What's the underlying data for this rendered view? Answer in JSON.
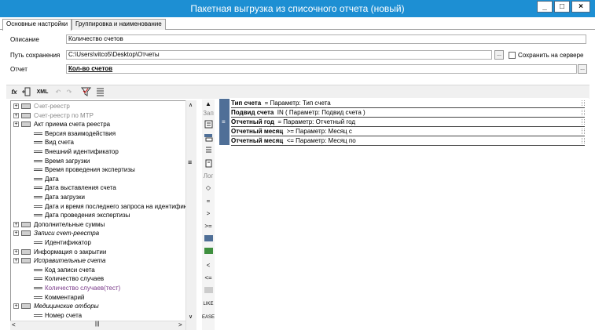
{
  "window": {
    "title": "Пакетная выгрузка из списочного отчета (новый)",
    "minimize": "_",
    "maximize": "□",
    "close": "×"
  },
  "tabs": [
    {
      "label": "Основные настройки",
      "active": true
    },
    {
      "label": "Группировка и наименование",
      "active": false
    }
  ],
  "form": {
    "description_label": "Описание",
    "description_value": "Количество счетов",
    "save_path_label": "Путь сохранения",
    "save_path_value": "C:\\Users\\vitco5\\Desktop\\Отчеты",
    "browse_label": "...",
    "save_on_server_label": "Сохранить на сервере",
    "report_label": "Отчет",
    "report_value": "Кол-во счетов",
    "report_browse_label": "..."
  },
  "toolbar": {
    "fx": "fx",
    "xml": "XML",
    "undo": "↶",
    "redo": "↷"
  },
  "tree": [
    {
      "label": "Счет-реестр",
      "expander": "+",
      "icon": "group",
      "gray": true
    },
    {
      "label": "Счет-реестр по МТР",
      "expander": "+",
      "icon": "group",
      "gray": true
    },
    {
      "label": "Акт приема счета реестра",
      "expander": "+",
      "icon": "group",
      "gray": false
    },
    {
      "label": "Версия взаимодействия",
      "expander": "",
      "icon": "field",
      "gray": false
    },
    {
      "label": "Вид счета",
      "expander": "",
      "icon": "field",
      "gray": false
    },
    {
      "label": "Внешний идентификатор",
      "expander": "",
      "icon": "field",
      "gray": false
    },
    {
      "label": "Время загрузки",
      "expander": "",
      "icon": "field",
      "gray": false
    },
    {
      "label": "Время проведения экспертизы",
      "expander": "",
      "icon": "field",
      "gray": false
    },
    {
      "label": "Дата",
      "expander": "",
      "icon": "field",
      "gray": false
    },
    {
      "label": "Дата выставления счета",
      "expander": "",
      "icon": "field",
      "gray": false
    },
    {
      "label": "Дата загрузки",
      "expander": "",
      "icon": "field",
      "gray": false
    },
    {
      "label": "Дата и время последнего запроса на идентификаци",
      "expander": "",
      "icon": "field",
      "gray": false
    },
    {
      "label": "Дата проведения экспертизы",
      "expander": "",
      "icon": "field",
      "gray": false
    },
    {
      "label": "Дополнительные суммы",
      "expander": "+",
      "icon": "group",
      "gray": false
    },
    {
      "label": "Записи счет-реестра",
      "expander": "+",
      "icon": "group",
      "gray": false,
      "italic": true
    },
    {
      "label": "Идентификатор",
      "expander": "",
      "icon": "field",
      "gray": false
    },
    {
      "label": "Информация о закрытии",
      "expander": "+",
      "icon": "group",
      "gray": false
    },
    {
      "label": "Исправительные счета",
      "expander": "+",
      "icon": "group",
      "gray": false,
      "italic": true
    },
    {
      "label": "Код записи счета",
      "expander": "",
      "icon": "field",
      "gray": false
    },
    {
      "label": "Количество случаев",
      "expander": "",
      "icon": "field",
      "gray": false
    },
    {
      "label": "Количество случаев(тест)",
      "expander": "",
      "icon": "field",
      "gray": false,
      "purple": true
    },
    {
      "label": "Комментарий",
      "expander": "",
      "icon": "field",
      "gray": false
    },
    {
      "label": "Медицинские отборы",
      "expander": "+",
      "icon": "group",
      "gray": false,
      "italic": true
    },
    {
      "label": "Номер счета",
      "expander": "",
      "icon": "field",
      "gray": false
    }
  ],
  "ops": [
    "Зап",
    "",
    "",
    "",
    "",
    "Лог",
    "◇",
    "=",
    ">",
    ">=",
    "",
    "",
    "<",
    "<=",
    "",
    "LIKE",
    "EASE"
  ],
  "conditions": [
    {
      "field": "Тип счета",
      "op": "= Параметр: Тип счета"
    },
    {
      "field": "Подвид счета",
      "op": "IN ( Параметр: Подвид счета )"
    },
    {
      "field": "Отчетный год",
      "op": "= Параметр: Отчетный год"
    },
    {
      "field": "Отчетный месяц",
      "op": ">= Параметр: Месяц с"
    },
    {
      "field": "Отчетный месяц",
      "op": "<= Параметр: Месяц по"
    }
  ],
  "and_label": "≡"
}
